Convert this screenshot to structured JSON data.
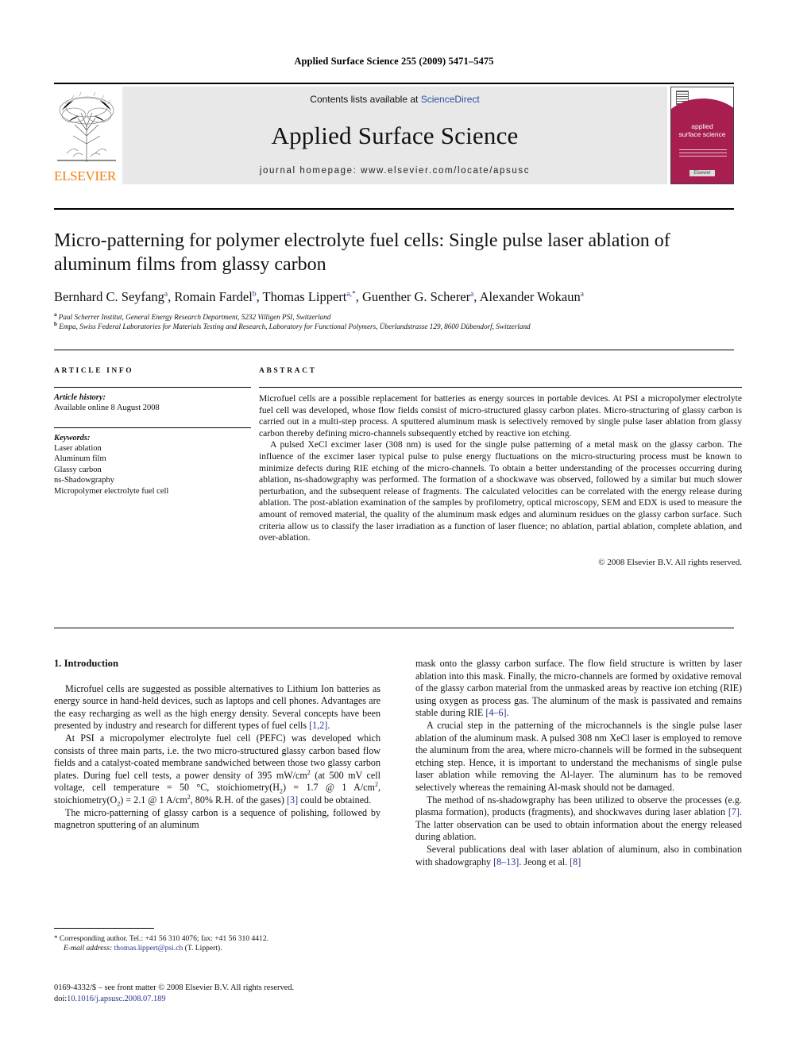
{
  "running_head": "Applied Surface Science 255 (2009) 5471–5475",
  "masthead": {
    "publisher_wordmark": "ELSEVIER",
    "contents_prefix": "Contents lists available at ",
    "contents_link": "ScienceDirect",
    "journal_name": "Applied Surface Science",
    "homepage_line": "journal homepage: www.elsevier.com/locate/apsusc",
    "cover": {
      "title_line1": "applied",
      "title_line2": "surface science",
      "footer_label": "Elsevier"
    }
  },
  "article": {
    "title": "Micro-patterning for polymer electrolyte fuel cells: Single pulse laser ablation of aluminum films from glassy carbon",
    "authors": [
      {
        "name": "Bernhard C. Seyfang",
        "marks": "a"
      },
      {
        "name": "Romain Fardel",
        "marks": "b"
      },
      {
        "name": "Thomas Lippert",
        "marks": "a,*"
      },
      {
        "name": "Guenther G. Scherer",
        "marks": "a"
      },
      {
        "name": "Alexander Wokaun",
        "marks": "a"
      }
    ],
    "affiliations": [
      {
        "mark": "a",
        "text": "Paul Scherrer Institut, General Energy Research Department, 5232 Villigen PSI, Switzerland"
      },
      {
        "mark": "b",
        "text": "Empa, Swiss Federal Laboratories for Materials Testing and Research, Laboratory for Functional Polymers, Überlandstrasse 129, 8600 Dübendorf, Switzerland"
      }
    ]
  },
  "article_info": {
    "heading": "ARTICLE INFO",
    "history_label": "Article history:",
    "history_value": "Available online 8 August 2008",
    "keywords_label": "Keywords:",
    "keywords": [
      "Laser ablation",
      "Aluminum film",
      "Glassy carbon",
      "ns-Shadowgraphy",
      "Micropolymer electrolyte fuel cell"
    ]
  },
  "abstract": {
    "heading": "ABSTRACT",
    "paragraphs": [
      "Microfuel cells are a possible replacement for batteries as energy sources in portable devices. At PSI a micropolymer electrolyte fuel cell was developed, whose flow fields consist of micro-structured glassy carbon plates. Micro-structuring of glassy carbon is carried out in a multi-step process. A sputtered aluminum mask is selectively removed by single pulse laser ablation from glassy carbon thereby defining micro-channels subsequently etched by reactive ion etching.",
      "A pulsed XeCl excimer laser (308 nm) is used for the single pulse patterning of a metal mask on the glassy carbon. The influence of the excimer laser typical pulse to pulse energy fluctuations on the micro-structuring process must be known to minimize defects during RIE etching of the micro-channels. To obtain a better understanding of the processes occurring during ablation, ns-shadowgraphy was performed. The formation of a shockwave was observed, followed by a similar but much slower perturbation, and the subsequent release of fragments. The calculated velocities can be correlated with the energy release during ablation. The post-ablation examination of the samples by profilometry, optical microscopy, SEM and EDX is used to measure the amount of removed material, the quality of the aluminum mask edges and aluminum residues on the glassy carbon surface. Such criteria allow us to classify the laser irradiation as a function of laser fluence; no ablation, partial ablation, complete ablation, and over-ablation."
    ],
    "copyright": "© 2008 Elsevier B.V. All rights reserved."
  },
  "body": {
    "section_number_title": "1. Introduction",
    "left_paragraphs": [
      "Microfuel cells are suggested as possible alternatives to Lithium Ion batteries as energy source in hand-held devices, such as laptops and cell phones. Advantages are the easy recharging as well as the high energy density. Several concepts have been presented by industry and research for different types of fuel cells [1,2].",
      "At PSI a micropolymer electrolyte fuel cell (PEFC) was developed which consists of three main parts, i.e. the two micro-structured glassy carbon based flow fields and a catalyst-coated membrane sandwiched between those two glassy carbon plates. During fuel cell tests, a power density of 395 mW/cm2 (at 500 mV cell voltage, cell temperature = 50 °C, stoichiometry(H2) = 1.7 @ 1 A/cm2, stoichiometry(O2) = 2.1 @ 1 A/cm2, 80% R.H. of the gases) [3] could be obtained.",
      "The micro-patterning of glassy carbon is a sequence of polishing, followed by magnetron sputtering of an aluminum"
    ],
    "right_paragraphs": [
      "mask onto the glassy carbon surface. The flow field structure is written by laser ablation into this mask. Finally, the micro-channels are formed by oxidative removal of the glassy carbon material from the unmasked areas by reactive ion etching (RIE) using oxygen as process gas. The aluminum of the mask is passivated and remains stable during RIE [4–6].",
      "A crucial step in the patterning of the microchannels is the single pulse laser ablation of the aluminum mask. A pulsed 308 nm XeCl laser is employed to remove the aluminum from the area, where micro-channels will be formed in the subsequent etching step. Hence, it is important to understand the mechanisms of single pulse laser ablation while removing the Al-layer. The aluminum has to be removed selectively whereas the remaining Al-mask should not be damaged.",
      "The method of ns-shadowgraphy has been utilized to observe the processes (e.g. plasma formation), products (fragments), and shockwaves during laser ablation [7]. The latter observation can be used to obtain information about the energy released during ablation.",
      "Several publications deal with laser ablation of aluminum, also in combination with shadowgraphy [8–13]. Jeong et al. [8]"
    ]
  },
  "footnotes": {
    "corresponding": "Corresponding author. Tel.: +41 56 310 4076; fax: +41 56 310 4412.",
    "email_label": "E-mail address:",
    "email": "thomas.lippert@psi.ch",
    "email_suffix": "(T. Lippert)."
  },
  "imprint": {
    "line1": "0169-4332/$ – see front matter © 2008 Elsevier B.V. All rights reserved.",
    "doi_label": "doi:",
    "doi_value": "10.1016/j.apsusc.2008.07.189"
  }
}
